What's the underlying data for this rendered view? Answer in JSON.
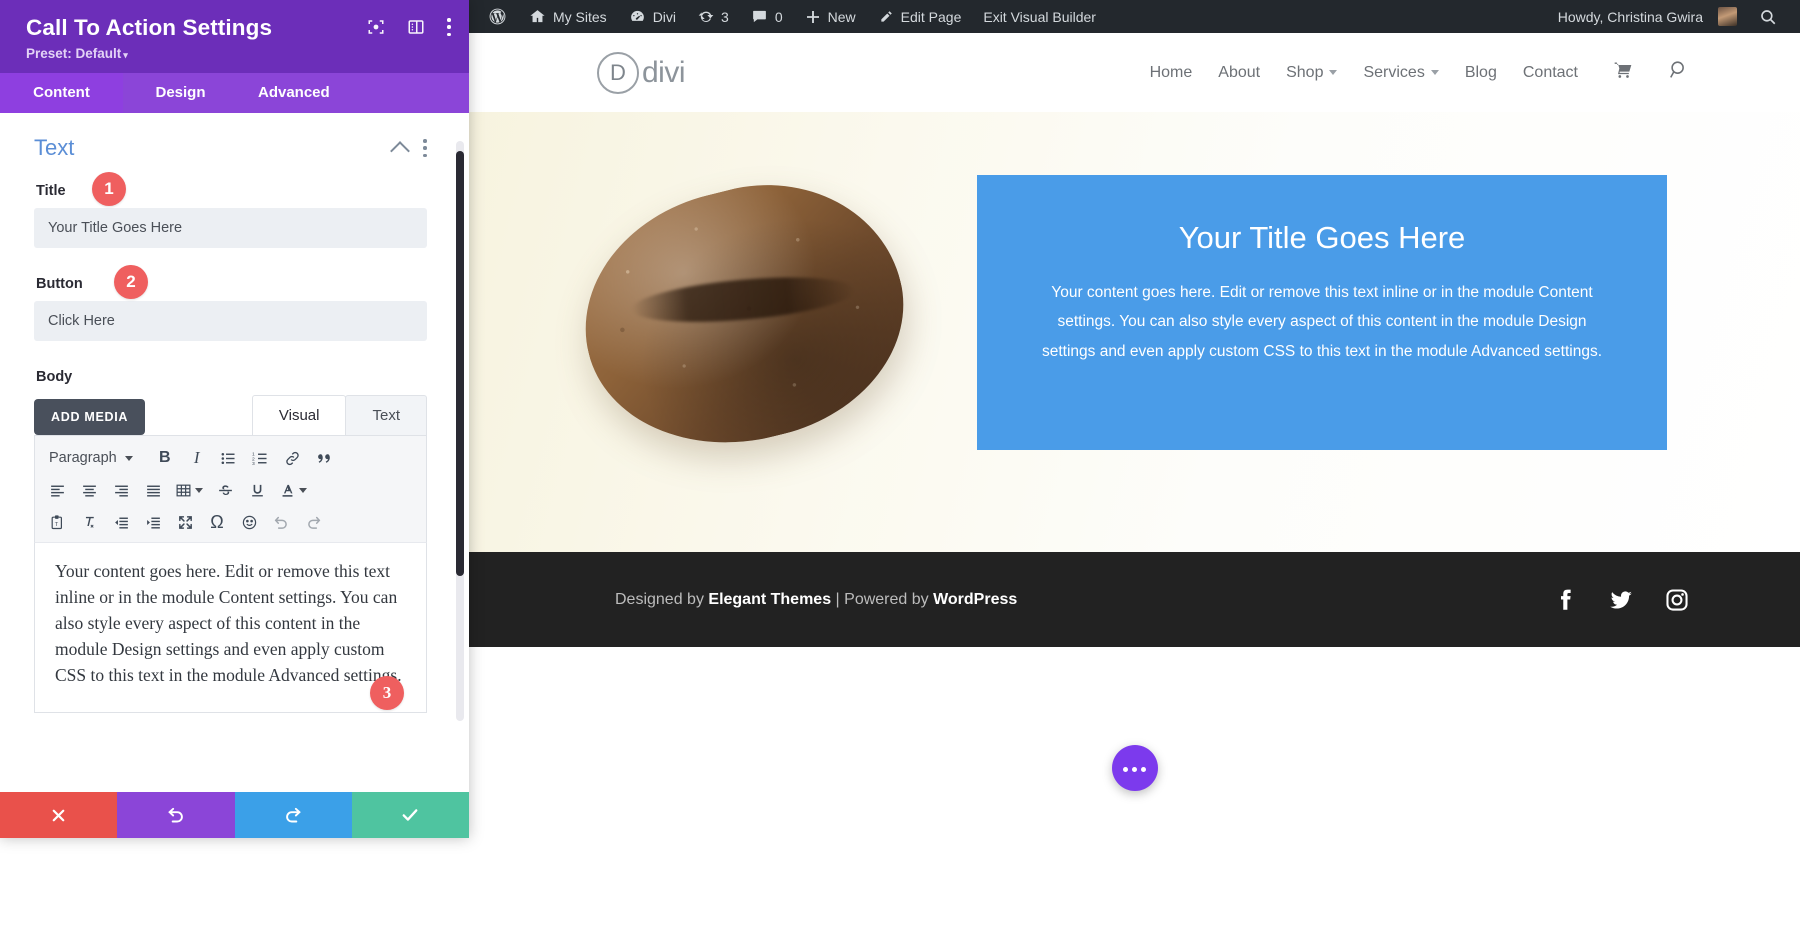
{
  "settings_panel": {
    "title": "Call To Action Settings",
    "preset_label": "Preset: Default",
    "header_icons": [
      "focus-target-icon",
      "layout-panel-icon",
      "vertical-dots-icon"
    ],
    "tabs": [
      {
        "label": "Content",
        "active": true
      },
      {
        "label": "Design",
        "active": false
      },
      {
        "label": "Advanced",
        "active": false
      }
    ],
    "section": {
      "title": "Text",
      "collapse_icon": "chevron-up-icon",
      "more_icon": "vertical-dots-icon"
    },
    "fields": {
      "title_label": "Title",
      "title_value": "Your Title Goes Here",
      "button_label": "Button",
      "button_value": "Click Here",
      "body_label": "Body"
    },
    "step_badges": [
      {
        "number": "1"
      },
      {
        "number": "2"
      },
      {
        "number": "3"
      }
    ],
    "editor": {
      "add_media_label": "ADD MEDIA",
      "tabs": [
        {
          "label": "Visual",
          "active": true
        },
        {
          "label": "Text",
          "active": false
        }
      ],
      "format_select": "Paragraph",
      "toolbar_row1": [
        "bold-icon",
        "italic-icon",
        "bulleted-list-icon",
        "numbered-list-icon",
        "link-icon",
        "blockquote-icon"
      ],
      "toolbar_row2": [
        "align-left-icon",
        "align-center-icon",
        "align-right-icon",
        "align-justify-icon",
        "table-icon",
        "strikethrough-icon",
        "underline-icon",
        "text-color-icon"
      ],
      "toolbar_row3": [
        "paste-as-text-icon",
        "clear-formatting-icon",
        "outdent-icon",
        "indent-icon",
        "fullscreen-icon",
        "special-character-icon",
        "emoji-icon",
        "undo-icon",
        "redo-icon"
      ],
      "body_text": "Your content goes here. Edit or remove this text inline or in the module Content settings. You can also style every aspect of this content in the module Design settings and even apply custom CSS to this text in the module Advanced settings."
    },
    "actions": [
      {
        "name": "cancel",
        "icon": "close-icon",
        "color": "#e9514b"
      },
      {
        "name": "undo",
        "icon": "undo-icon",
        "color": "#8b45d8"
      },
      {
        "name": "redo",
        "icon": "redo-icon",
        "color": "#3ba0e8"
      },
      {
        "name": "save",
        "icon": "check-icon",
        "color": "#4fc4a0"
      }
    ]
  },
  "admin_bar": {
    "items": [
      {
        "label": "",
        "icon": "wordpress-logo-icon"
      },
      {
        "label": "My Sites",
        "icon": "sites-icon"
      },
      {
        "label": "Divi",
        "icon": "dashboard-icon"
      },
      {
        "label": "3",
        "icon": "updates-icon"
      },
      {
        "label": "0",
        "icon": "comments-icon"
      },
      {
        "label": "New",
        "icon": "plus-icon"
      },
      {
        "label": "Edit Page",
        "icon": "pencil-icon"
      },
      {
        "label": "Exit Visual Builder",
        "icon": ""
      }
    ],
    "howdy": "Howdy, Christina Gwira",
    "avatar": "user-avatar",
    "search_icon": "search-icon"
  },
  "site": {
    "logo_letter": "D",
    "logo_word": "divi",
    "nav": [
      {
        "label": "Home",
        "has_dropdown": false
      },
      {
        "label": "About",
        "has_dropdown": false
      },
      {
        "label": "Shop",
        "has_dropdown": true
      },
      {
        "label": "Services",
        "has_dropdown": true
      },
      {
        "label": "Blog",
        "has_dropdown": false
      },
      {
        "label": "Contact",
        "has_dropdown": false
      }
    ],
    "nav_icons": [
      "cart-icon",
      "search-icon"
    ],
    "cta": {
      "title": "Your Title Goes Here",
      "body": "Your content goes here. Edit or remove this text inline or in the module Content settings. You can also style every aspect of this content in the module Design settings and even apply custom CSS to this text in the module Advanced settings.",
      "background_color": "#4a9ce8"
    },
    "hero_image_alt": "loaf-of-bread-photo",
    "footer": {
      "prefix": "Designed by ",
      "brand": "Elegant Themes",
      "middle": " | Powered by ",
      "platform": "WordPress",
      "social": [
        "facebook-icon",
        "twitter-icon",
        "instagram-icon"
      ]
    },
    "fab_icon": "ellipsis-icon"
  },
  "colors": {
    "panel_purple": "#6c2eb9",
    "tab_purple": "#8e3fe0",
    "accent_blue": "#5b8ed6",
    "badge_red": "#ef5f5f",
    "cta_blue": "#4a9ce8"
  }
}
